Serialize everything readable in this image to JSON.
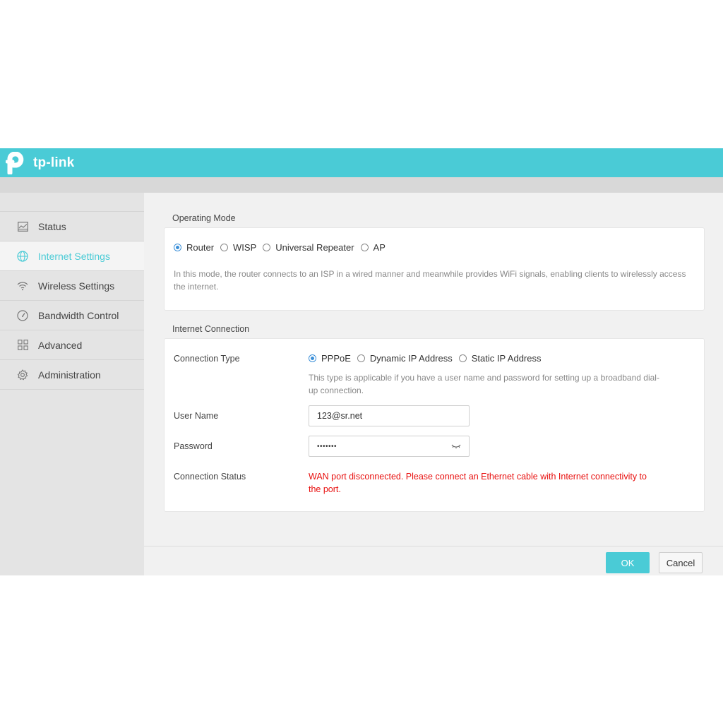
{
  "brand": {
    "name": "tp-link",
    "accent": "#4acbd6"
  },
  "sidebar": {
    "items": [
      {
        "label": "Status",
        "icon": "chart-icon"
      },
      {
        "label": "Internet Settings",
        "icon": "globe-icon",
        "active": true
      },
      {
        "label": "Wireless Settings",
        "icon": "wifi-icon"
      },
      {
        "label": "Bandwidth Control",
        "icon": "gauge-icon"
      },
      {
        "label": "Advanced",
        "icon": "grid-icon"
      },
      {
        "label": "Administration",
        "icon": "gear-icon"
      }
    ]
  },
  "operating_mode": {
    "title": "Operating Mode",
    "options": [
      "Router",
      "WISP",
      "Universal Repeater",
      "AP"
    ],
    "selected": "Router",
    "description": "In this mode, the router connects to an ISP in a wired manner and meanwhile provides WiFi signals, enabling clients to wirelessly access the internet."
  },
  "internet_connection": {
    "title": "Internet Connection",
    "connection_type_label": "Connection Type",
    "connection_options": [
      "PPPoE",
      "Dynamic IP Address",
      "Static IP Address"
    ],
    "selected": "PPPoE",
    "type_description": "This type is applicable if you have a user name and password for setting up a broadband dial-up connection.",
    "username_label": "User Name",
    "username_value": "123@sr.net",
    "password_label": "Password",
    "password_value": "•••••••",
    "status_label": "Connection Status",
    "status_value": "WAN port disconnected. Please connect an Ethernet cable with Internet connectivity to the port.",
    "status_color": "#e8100f"
  },
  "footer": {
    "ok_label": "OK",
    "cancel_label": "Cancel"
  }
}
